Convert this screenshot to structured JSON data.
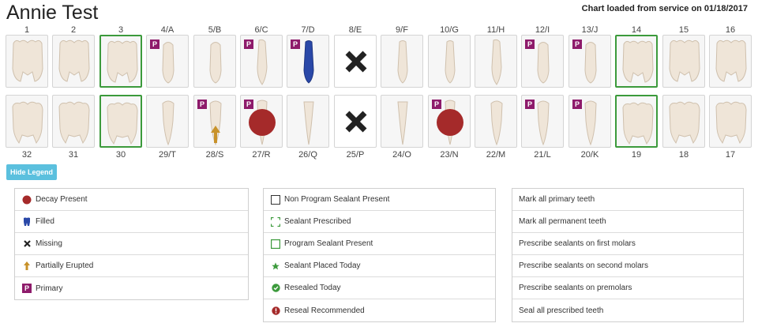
{
  "header": {
    "patient_name": "Annie Test",
    "chart_loaded": "Chart loaded from service on 01/18/2017"
  },
  "upper_labels": [
    "1",
    "2",
    "3",
    "4/A",
    "5/B",
    "6/C",
    "7/D",
    "8/E",
    "9/F",
    "10/G",
    "11/H",
    "12/I",
    "13/J",
    "14",
    "15",
    "16"
  ],
  "lower_labels": [
    "32",
    "31",
    "30",
    "29/T",
    "28/S",
    "27/R",
    "26/Q",
    "25/P",
    "24/O",
    "23/N",
    "22/M",
    "21/L",
    "20/K",
    "19",
    "18",
    "17"
  ],
  "upper_teeth": [
    {
      "shape": "molar",
      "primary": false,
      "sealant_present": false,
      "filled": false,
      "missing": false,
      "decay": false,
      "erupting": false
    },
    {
      "shape": "molar",
      "primary": false,
      "sealant_present": false,
      "filled": false,
      "missing": false,
      "decay": false,
      "erupting": false
    },
    {
      "shape": "molar",
      "primary": false,
      "sealant_present": true,
      "filled": false,
      "missing": false,
      "decay": false,
      "erupting": false
    },
    {
      "shape": "premolar",
      "primary": true,
      "sealant_present": false,
      "filled": false,
      "missing": false,
      "decay": false,
      "erupting": false
    },
    {
      "shape": "premolar",
      "primary": false,
      "sealant_present": false,
      "filled": false,
      "missing": false,
      "decay": false,
      "erupting": false
    },
    {
      "shape": "canine",
      "primary": true,
      "sealant_present": false,
      "filled": false,
      "missing": false,
      "decay": false,
      "erupting": false
    },
    {
      "shape": "incisor",
      "primary": true,
      "sealant_present": false,
      "filled": true,
      "missing": false,
      "decay": false,
      "erupting": false
    },
    {
      "shape": "incisor",
      "primary": false,
      "sealant_present": false,
      "filled": false,
      "missing": true,
      "decay": false,
      "erupting": false
    },
    {
      "shape": "incisor",
      "primary": false,
      "sealant_present": false,
      "filled": false,
      "missing": false,
      "decay": false,
      "erupting": false
    },
    {
      "shape": "incisor",
      "primary": false,
      "sealant_present": false,
      "filled": false,
      "missing": false,
      "decay": false,
      "erupting": false
    },
    {
      "shape": "canine",
      "primary": false,
      "sealant_present": false,
      "filled": false,
      "missing": false,
      "decay": false,
      "erupting": false
    },
    {
      "shape": "premolar",
      "primary": true,
      "sealant_present": false,
      "filled": false,
      "missing": false,
      "decay": false,
      "erupting": false
    },
    {
      "shape": "premolar",
      "primary": true,
      "sealant_present": false,
      "filled": false,
      "missing": false,
      "decay": false,
      "erupting": false
    },
    {
      "shape": "molar",
      "primary": false,
      "sealant_present": true,
      "filled": false,
      "missing": false,
      "decay": false,
      "erupting": false
    },
    {
      "shape": "molar",
      "primary": false,
      "sealant_present": false,
      "filled": false,
      "missing": false,
      "decay": false,
      "erupting": false
    },
    {
      "shape": "molar",
      "primary": false,
      "sealant_present": false,
      "filled": false,
      "missing": false,
      "decay": false,
      "erupting": false
    }
  ],
  "lower_teeth": [
    {
      "shape": "molar",
      "primary": false,
      "sealant_present": false,
      "filled": false,
      "missing": false,
      "decay": false,
      "erupting": false
    },
    {
      "shape": "molar",
      "primary": false,
      "sealant_present": false,
      "filled": false,
      "missing": false,
      "decay": false,
      "erupting": false
    },
    {
      "shape": "molar",
      "primary": false,
      "sealant_present": true,
      "filled": false,
      "missing": false,
      "decay": false,
      "erupting": false
    },
    {
      "shape": "premolar",
      "primary": false,
      "sealant_present": false,
      "filled": false,
      "missing": false,
      "decay": false,
      "erupting": false
    },
    {
      "shape": "premolar",
      "primary": true,
      "sealant_present": false,
      "filled": false,
      "missing": false,
      "decay": false,
      "erupting": true
    },
    {
      "shape": "canine",
      "primary": true,
      "sealant_present": false,
      "filled": false,
      "missing": false,
      "decay": true,
      "erupting": false
    },
    {
      "shape": "incisor",
      "primary": false,
      "sealant_present": false,
      "filled": false,
      "missing": false,
      "decay": false,
      "erupting": false
    },
    {
      "shape": "incisor",
      "primary": false,
      "sealant_present": false,
      "filled": false,
      "missing": true,
      "decay": false,
      "erupting": false
    },
    {
      "shape": "incisor",
      "primary": false,
      "sealant_present": false,
      "filled": false,
      "missing": false,
      "decay": false,
      "erupting": false
    },
    {
      "shape": "canine",
      "primary": true,
      "sealant_present": false,
      "filled": false,
      "missing": false,
      "decay": true,
      "erupting": false
    },
    {
      "shape": "premolar",
      "primary": false,
      "sealant_present": false,
      "filled": false,
      "missing": false,
      "decay": false,
      "erupting": false
    },
    {
      "shape": "premolar",
      "primary": true,
      "sealant_present": false,
      "filled": false,
      "missing": false,
      "decay": false,
      "erupting": false
    },
    {
      "shape": "premolar",
      "primary": true,
      "sealant_present": false,
      "filled": false,
      "missing": false,
      "decay": false,
      "erupting": false
    },
    {
      "shape": "molar",
      "primary": false,
      "sealant_present": true,
      "filled": false,
      "missing": false,
      "decay": false,
      "erupting": false
    },
    {
      "shape": "molar",
      "primary": false,
      "sealant_present": false,
      "filled": false,
      "missing": false,
      "decay": false,
      "erupting": false
    },
    {
      "shape": "molar",
      "primary": false,
      "sealant_present": false,
      "filled": false,
      "missing": false,
      "decay": false,
      "erupting": false
    }
  ],
  "primary_badge": "P",
  "hide_legend_label": "Hide Legend",
  "legend_conditions": [
    {
      "icon": "decay-icon",
      "label": "Decay Present"
    },
    {
      "icon": "filled-tooth-icon",
      "label": "Filled"
    },
    {
      "icon": "missing-x-icon",
      "label": "Missing"
    },
    {
      "icon": "erupting-arrow-icon",
      "label": "Partially Erupted"
    },
    {
      "icon": "primary-badge-icon",
      "label": "Primary"
    }
  ],
  "legend_sealants": [
    {
      "icon": "empty-square-icon",
      "label": "Non Program Sealant Present"
    },
    {
      "icon": "dashed-square-icon",
      "label": "Sealant Prescribed"
    },
    {
      "icon": "green-square-icon",
      "label": "Program Sealant Present"
    },
    {
      "icon": "star-icon",
      "label": "Sealant Placed Today"
    },
    {
      "icon": "check-circle-icon",
      "label": "Resealed Today"
    },
    {
      "icon": "exclamation-circle-icon",
      "label": "Reseal Recommended"
    }
  ],
  "actions": [
    "Mark all primary teeth",
    "Mark all permanent teeth",
    "Prescribe sealants on first molars",
    "Prescribe sealants on second molars",
    "Prescribe sealants on premolars",
    "Seal all prescribed teeth"
  ],
  "colors": {
    "decay": "#a52a2a",
    "primary_badge": "#8e1b6b",
    "sealant_green": "#3c9a3c",
    "filled_blue": "#2a48a8",
    "erupt_gold": "#c8922a",
    "button_blue": "#5bc0de"
  }
}
